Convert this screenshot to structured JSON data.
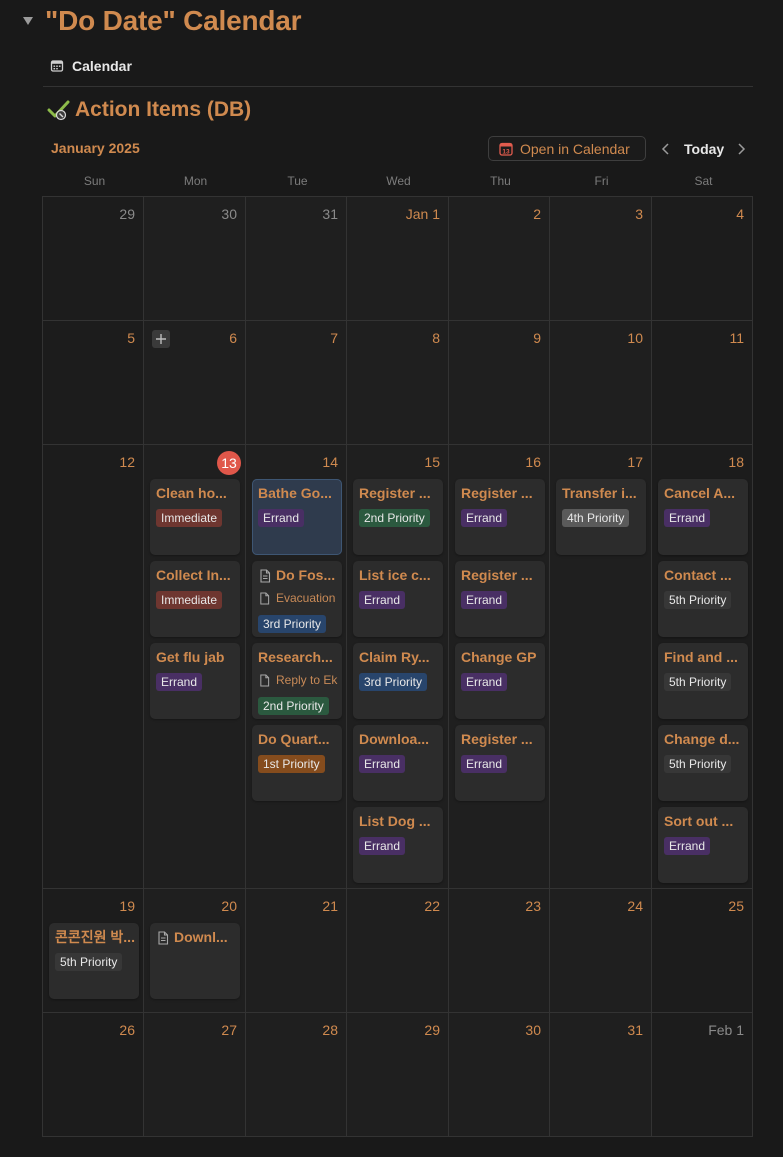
{
  "page": {
    "title": "\"Do Date\" Calendar"
  },
  "view_tab": {
    "label": "Calendar"
  },
  "database": {
    "title": "Action Items (DB)"
  },
  "toolbar": {
    "month": "January 2025",
    "open_in_calendar": "Open in Calendar",
    "today": "Today"
  },
  "weekdays": [
    "Sun",
    "Mon",
    "Tue",
    "Wed",
    "Thu",
    "Fri",
    "Sat"
  ],
  "weeks": [
    [
      {
        "label": "29",
        "muted": true
      },
      {
        "label": "30",
        "muted": true
      },
      {
        "label": "31",
        "muted": true
      },
      {
        "label": "Jan 1"
      },
      {
        "label": "2"
      },
      {
        "label": "3"
      },
      {
        "label": "4"
      }
    ],
    [
      {
        "label": "5"
      },
      {
        "label": "6",
        "add_button": true
      },
      {
        "label": "7"
      },
      {
        "label": "8"
      },
      {
        "label": "9"
      },
      {
        "label": "10"
      },
      {
        "label": "11"
      }
    ],
    [
      {
        "label": "12"
      },
      {
        "label": "13",
        "today": true,
        "cards": [
          {
            "title": "Clean ho...",
            "tag": "Immediate"
          },
          {
            "title": "Collect In...",
            "tag": "Immediate"
          },
          {
            "title": "Get flu jab",
            "tag": "Errand"
          }
        ]
      },
      {
        "label": "14",
        "cards": [
          {
            "title": "Bathe Go...",
            "tag": "Errand",
            "highlight": true
          },
          {
            "title": "Do Fos...",
            "doc_icon": true,
            "relation": "Evacuation",
            "tag": "3rd Priority"
          },
          {
            "title": "Research...",
            "relation": "Reply to Ek",
            "tag": "2nd Priority"
          },
          {
            "title": "Do Quart...",
            "tag": "1st Priority"
          }
        ]
      },
      {
        "label": "15",
        "cards": [
          {
            "title": "Register ...",
            "tag": "2nd Priority"
          },
          {
            "title": "List ice c...",
            "tag": "Errand"
          },
          {
            "title": "Claim Ry...",
            "tag": "3rd Priority"
          },
          {
            "title": "Downloa...",
            "tag": "Errand"
          },
          {
            "title": "List Dog ...",
            "tag": "Errand"
          }
        ]
      },
      {
        "label": "16",
        "cards": [
          {
            "title": "Register ...",
            "tag": "Errand"
          },
          {
            "title": "Register ...",
            "tag": "Errand"
          },
          {
            "title": "Change GP",
            "tag": "Errand"
          },
          {
            "title": "Register ...",
            "tag": "Errand"
          }
        ]
      },
      {
        "label": "17",
        "cards": [
          {
            "title": "Transfer i...",
            "tag": "4th Priority"
          }
        ]
      },
      {
        "label": "18",
        "cards": [
          {
            "title": "Cancel A...",
            "tag": "Errand"
          },
          {
            "title": "Contact ...",
            "tag": "5th Priority"
          },
          {
            "title": "Find and ...",
            "tag": "5th Priority"
          },
          {
            "title": "Change d...",
            "tag": "5th Priority"
          },
          {
            "title": "Sort out ...",
            "tag": "Errand"
          }
        ]
      }
    ],
    [
      {
        "label": "19",
        "cards": [
          {
            "title": "콘콘진원 박...",
            "tag": "5th Priority"
          }
        ]
      },
      {
        "label": "20",
        "cards": [
          {
            "title": "Downl...",
            "doc_icon": true
          }
        ]
      },
      {
        "label": "21"
      },
      {
        "label": "22"
      },
      {
        "label": "23"
      },
      {
        "label": "24"
      },
      {
        "label": "25"
      }
    ],
    [
      {
        "label": "26"
      },
      {
        "label": "27"
      },
      {
        "label": "28"
      },
      {
        "label": "29"
      },
      {
        "label": "30"
      },
      {
        "label": "31"
      },
      {
        "label": "Feb 1",
        "muted": true
      }
    ]
  ],
  "tag_styles": {
    "Errand": "tag-errand",
    "Immediate": "tag-immediate",
    "1st Priority": "tag-p1",
    "2nd Priority": "tag-p2",
    "3rd Priority": "tag-p3",
    "4th Priority": "tag-p4",
    "5th Priority": "tag-p5"
  },
  "colors": {
    "accent": "#d08a4f",
    "today": "#e0574a",
    "background": "#191919"
  },
  "icons": {
    "toggle": "triangle-down-icon",
    "view_tab": "calendar-icon",
    "database": "checkmark-icon",
    "open_in_calendar": "calendar-icon",
    "prev": "chevron-left-icon",
    "next": "chevron-right-icon",
    "add": "plus-icon",
    "page": "page-icon"
  }
}
